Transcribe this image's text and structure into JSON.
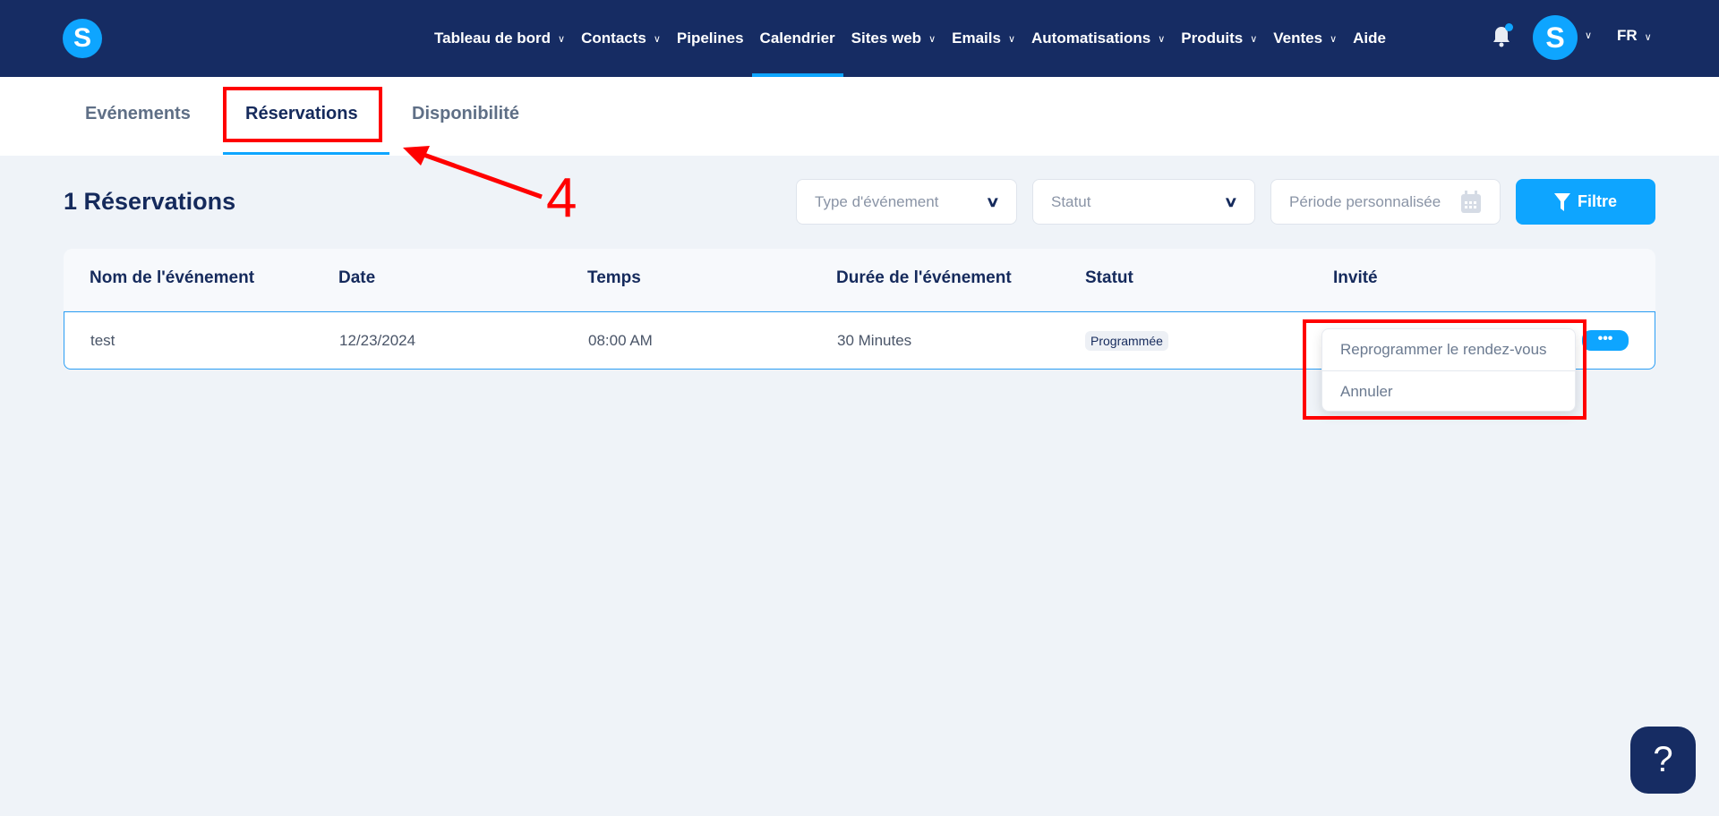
{
  "nav": {
    "logo": "S",
    "items": [
      {
        "label": "Tableau de bord",
        "dropdown": true
      },
      {
        "label": "Contacts",
        "dropdown": true
      },
      {
        "label": "Pipelines",
        "dropdown": false
      },
      {
        "label": "Calendrier",
        "dropdown": false,
        "active": true
      },
      {
        "label": "Sites web",
        "dropdown": true
      },
      {
        "label": "Emails",
        "dropdown": true
      },
      {
        "label": "Automatisations",
        "dropdown": true
      },
      {
        "label": "Produits",
        "dropdown": true
      },
      {
        "label": "Ventes",
        "dropdown": true
      },
      {
        "label": "Aide",
        "dropdown": false
      }
    ],
    "avatar": "S",
    "language": "FR"
  },
  "tabs": [
    {
      "label": "Evénements"
    },
    {
      "label": "Réservations",
      "active": true
    },
    {
      "label": "Disponibilité"
    }
  ],
  "annotation": {
    "step": "4"
  },
  "page": {
    "title": "1 Réservations"
  },
  "filters": {
    "event_type": "Type d'événement",
    "status": "Statut",
    "period": "Période personnalisée",
    "filter_button": "Filtre"
  },
  "table": {
    "headers": [
      "Nom de l'événement",
      "Date",
      "Temps",
      "Durée de l'événement",
      "Statut",
      "Invité"
    ],
    "rows": [
      {
        "name": "test",
        "date": "12/23/2024",
        "time": "08:00 AM",
        "duration": "30 Minutes",
        "status": "Programmée",
        "guest": ""
      }
    ]
  },
  "actions_menu": {
    "button": "•••",
    "items": [
      "Reprogrammer le rendez-vous",
      "Annuler"
    ]
  },
  "help": "?",
  "colors": {
    "navy": "#162c63",
    "accent": "#0ea5ff",
    "background": "#eff3f8",
    "annotation": "#ff0000"
  }
}
